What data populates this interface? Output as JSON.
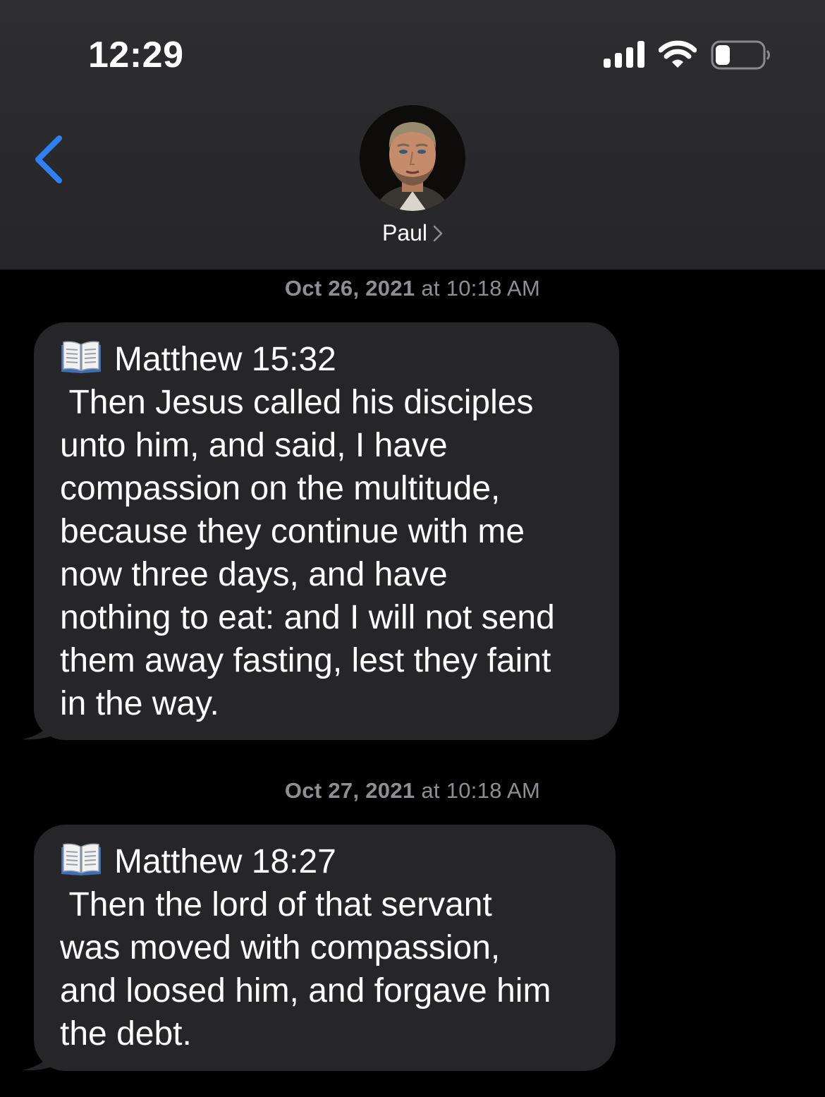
{
  "status_bar": {
    "time": "12:29",
    "icons": [
      "signal-icon",
      "wifi-icon",
      "battery-icon"
    ]
  },
  "header": {
    "back_icon": "chevron-left-icon",
    "contact_name": "Paul",
    "contact_chevron_icon": "chevron-right-icon"
  },
  "messages": [
    {
      "timestamp_date": "Oct 26, 2021",
      "timestamp_time": " at 10:18 AM",
      "icon": "open-book-icon",
      "reference": "Matthew 15:32",
      "lines": [
        " Then Jesus called his disciples",
        "unto him, and said, I have",
        "compassion on the multitude,",
        "because they continue with me",
        "now three days, and have",
        "nothing to eat: and I will not send",
        "them away fasting, lest they faint",
        "in the way."
      ]
    },
    {
      "timestamp_date": "Oct 27, 2021",
      "timestamp_time": " at 10:18 AM",
      "icon": "open-book-icon",
      "reference": "Matthew 18:27",
      "lines": [
        " Then the lord of that servant",
        "was moved with compassion,",
        "and loosed him, and forgave him",
        "the debt."
      ]
    }
  ],
  "colors": {
    "background": "#000000",
    "header": "#2c2c2e",
    "bubble": "#262628",
    "accent": "#2f80f6",
    "timestamp": "#8e8e93"
  }
}
